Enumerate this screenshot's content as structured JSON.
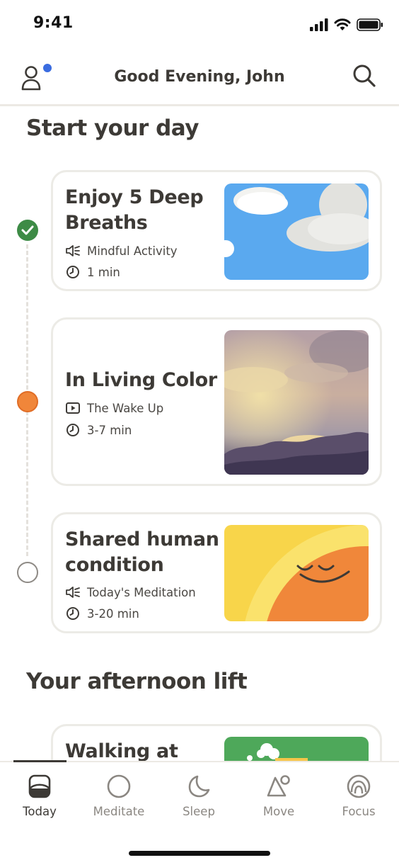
{
  "status_bar": {
    "time": "9:41"
  },
  "header": {
    "greeting": "Good Evening, John"
  },
  "sections": {
    "start_day": "Start your day",
    "afternoon": "Your afternoon lift"
  },
  "cards": [
    {
      "title": "Enjoy 5 Deep Breaths",
      "type": "Mindful Activity",
      "type_icon": "audio-icon",
      "duration": "1 min",
      "status": "completed"
    },
    {
      "title": "In Living Color",
      "type": "The Wake Up",
      "type_icon": "video-icon",
      "duration": "3-7 min",
      "status": "current"
    },
    {
      "title": "Shared human condition",
      "type": "Today's Meditation",
      "type_icon": "audio-icon",
      "duration": "3-20 min",
      "status": "pending"
    },
    {
      "title": "Walking at"
    }
  ],
  "tabs": [
    {
      "label": "Today",
      "icon": "today-icon",
      "active": true
    },
    {
      "label": "Meditate",
      "icon": "meditate-icon",
      "active": false
    },
    {
      "label": "Sleep",
      "icon": "moon-icon",
      "active": false
    },
    {
      "label": "Move",
      "icon": "move-icon",
      "active": false
    },
    {
      "label": "Focus",
      "icon": "focus-icon",
      "active": false
    }
  ],
  "colors": {
    "text": "#3d3a36",
    "completed": "#3d8b46",
    "current": "#f0863a",
    "notification": "#3a6ce0",
    "sky_blue": "#5aa9ef",
    "sun_orange": "#f0873a",
    "sun_yellow": "#f8d54a"
  }
}
